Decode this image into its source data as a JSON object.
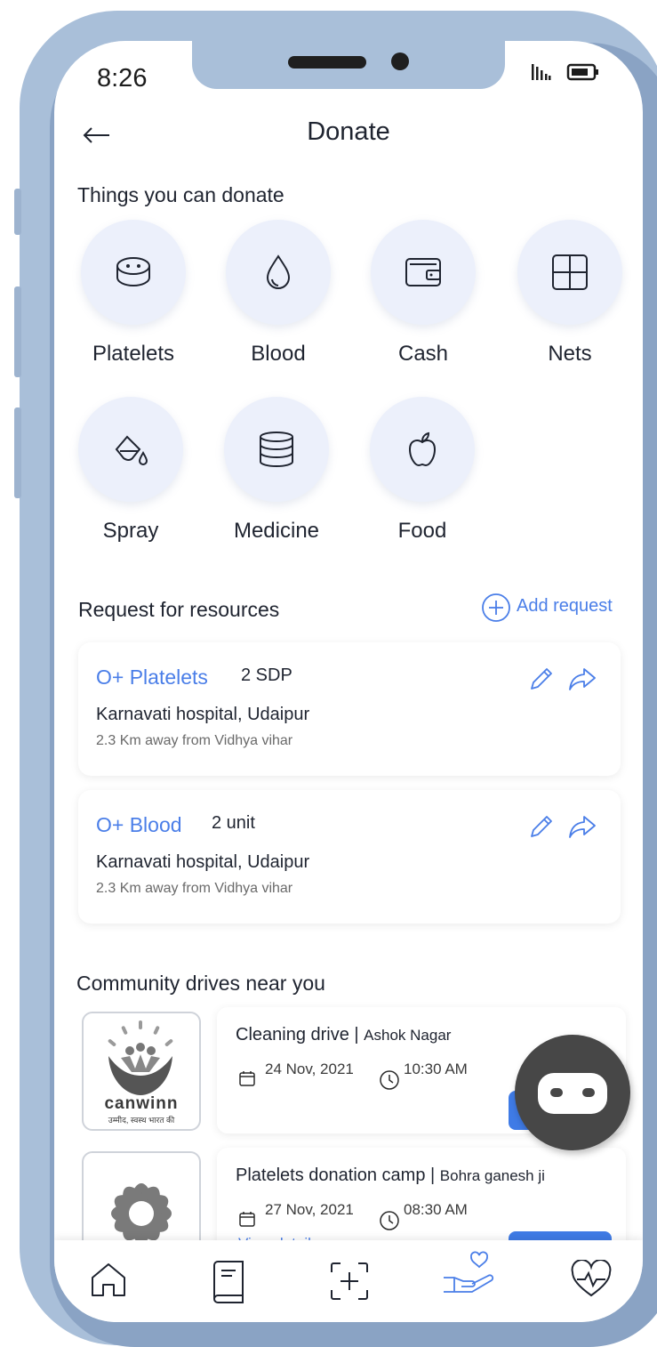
{
  "status_bar": {
    "time": "8:26"
  },
  "header": {
    "title": "Donate",
    "back_icon": "arrow-left-icon"
  },
  "donate_section": {
    "title": "Things you can donate",
    "items": [
      {
        "label": "Platelets",
        "icon": "platelets-icon"
      },
      {
        "label": "Blood",
        "icon": "blood-drop-icon"
      },
      {
        "label": "Cash",
        "icon": "wallet-icon"
      },
      {
        "label": "Nets",
        "icon": "net-icon"
      },
      {
        "label": "Spray",
        "icon": "spray-icon"
      },
      {
        "label": "Medicine",
        "icon": "medicine-icon"
      },
      {
        "label": "Food",
        "icon": "apple-icon"
      }
    ]
  },
  "requests_section": {
    "title": "Request for resources",
    "add_label": "Add request",
    "items": [
      {
        "title": "O+ Platelets",
        "quantity": "2 SDP",
        "hospital": "Karnavati hospital, Udaipur",
        "distance": "2.3 Km away from Vidhya vihar"
      },
      {
        "title": "O+ Blood",
        "quantity": "2 unit",
        "hospital": "Karnavati hospital, Udaipur",
        "distance": "2.3 Km away from Vidhya vihar"
      }
    ]
  },
  "drives_section": {
    "title": "Community drives near you",
    "items": [
      {
        "title": "Cleaning drive",
        "location": "Ashok Nagar",
        "date": "24 Nov, 2021",
        "time": "10:30 AM",
        "logo_text": "canwinn",
        "logo_tagline": "उम्मीद, स्वस्थ भारत की"
      },
      {
        "title": "Platelets donation camp",
        "location": "Bohra ganesh ji",
        "date": "27 Nov, 2021",
        "time": "08:30 AM",
        "view_details": "View details"
      }
    ]
  },
  "bottom_nav": [
    {
      "name": "home",
      "icon": "home-icon"
    },
    {
      "name": "book",
      "icon": "book-icon"
    },
    {
      "name": "scan",
      "icon": "scan-add-icon"
    },
    {
      "name": "donate",
      "icon": "hand-heart-icon",
      "active": true
    },
    {
      "name": "health",
      "icon": "heart-pulse-icon"
    }
  ],
  "colors": {
    "accent": "#4a7ee8",
    "circle_bg": "#ecf0fb",
    "frame": "#a9bfd9",
    "bot": "#474747"
  }
}
